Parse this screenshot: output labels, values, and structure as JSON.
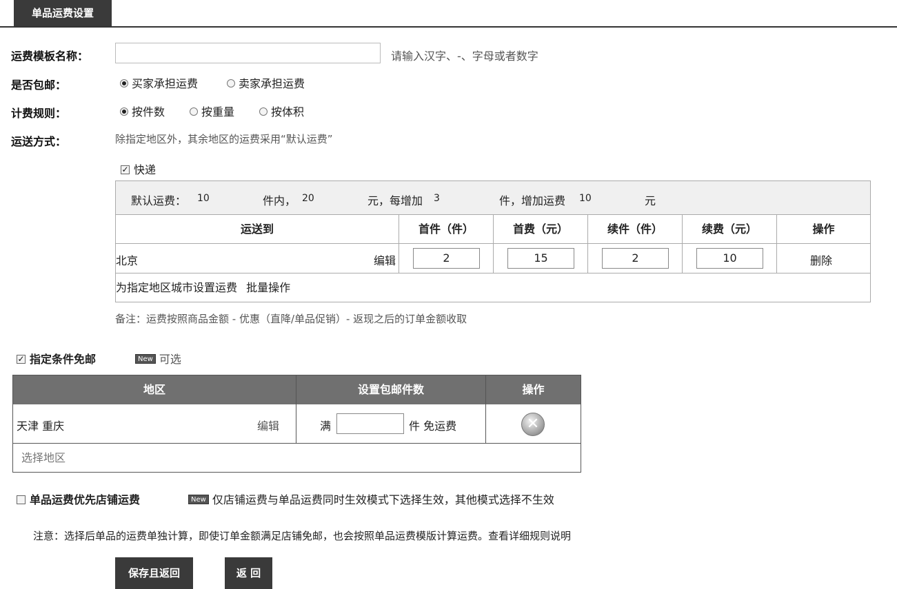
{
  "tab": {
    "label": "单品运费设置"
  },
  "template_name": {
    "label": "运费模板名称：",
    "value": "",
    "hint": "请输入汉字、-、字母或者数字"
  },
  "free_shipping": {
    "label": "是否包邮：",
    "options": [
      "买家承担运费",
      "卖家承担运费"
    ],
    "selected": "买家承担运费"
  },
  "billing_rule": {
    "label": "计费规则：",
    "options": [
      "按件数",
      "按重量",
      "按体积"
    ],
    "selected": "按件数"
  },
  "shipping_method": {
    "label": "运送方式：",
    "desc": "除指定地区外，其余地区的运费采用“默认运费”",
    "express_label": "快递",
    "express_checked": true
  },
  "default_fee": {
    "prefix": "默认运费：",
    "first_qty": "10",
    "unit1": "件内，",
    "first_fee": "20",
    "unit2": "元，每增加",
    "add_qty": "3",
    "unit3": "件，增加运费",
    "add_fee": "10",
    "unit4": "元"
  },
  "express_table": {
    "headers": [
      "运送到",
      "首件（件）",
      "首费（元）",
      "续件（件）",
      "续费（元）",
      "操作"
    ],
    "rows": [
      {
        "region": "北京",
        "edit": "编辑",
        "first_qty": "2",
        "first_fee": "15",
        "add_qty": "2",
        "add_fee": "10",
        "action": "删除"
      }
    ],
    "footer_set": "为指定地区城市设置运费",
    "footer_batch": "批量操作"
  },
  "remark": "备注：运费按照商品金额 - 优惠（直降/单品促销）- 返现之后的订单金额收取",
  "conditional_free": {
    "label": "指定条件免邮",
    "checked": true,
    "badge": "New",
    "note": "可选",
    "headers": [
      "地区",
      "设置包邮件数",
      "操作"
    ],
    "rows": [
      {
        "region": "天津 重庆",
        "edit": "编辑",
        "prefix": "满",
        "qty": "",
        "suffix": "件 免运费"
      }
    ],
    "footer": "选择地区"
  },
  "shop_priority": {
    "label": "单品运费优先店铺运费",
    "checked": false,
    "badge": "New",
    "note": "仅店铺运费与单品运费同时生效模式下选择生效，其他模式选择不生效"
  },
  "notice": "注意：选择后单品的运费单独计算，即使订单金额满足店铺免邮，也会按照单品运费模版计算运费。查看详细规则说明",
  "buttons": {
    "save": "保存且返回",
    "back": "返 回"
  }
}
